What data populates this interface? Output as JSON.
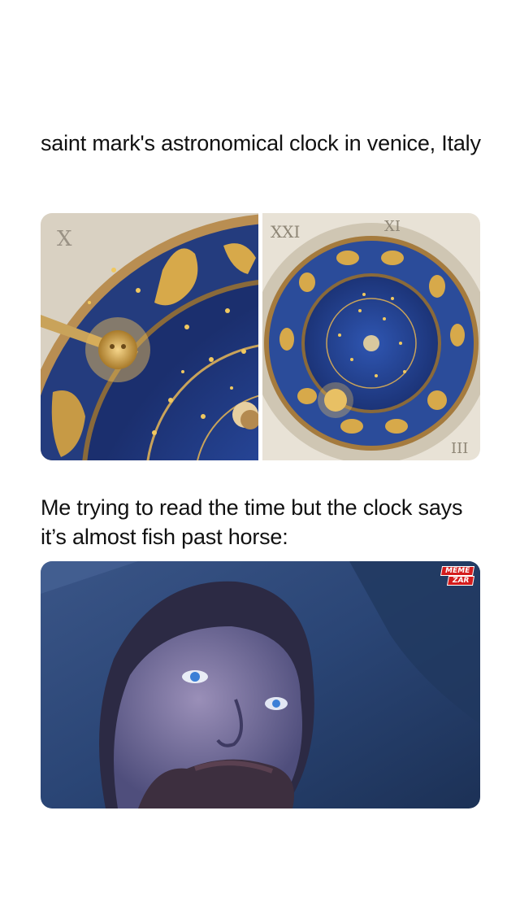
{
  "post": {
    "caption_1": "saint mark's astronomical clock in venice, Italy",
    "caption_2": "Me trying to read the time but the clock says it’s almost fish past horse:"
  },
  "watermark": {
    "line_1": "MEME",
    "line_2": "ZAR"
  },
  "colors": {
    "clock_blue": "#2a4fa3",
    "gold": "#d7a94a",
    "stone": "#e8e2d6",
    "scene_blue": "#27406f"
  }
}
